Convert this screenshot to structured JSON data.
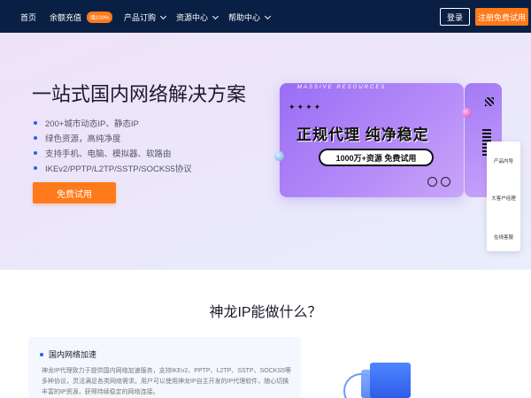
{
  "nav": {
    "home": "首页",
    "recharge": "余额充值",
    "recharge_badge": "赠100%",
    "products": "产品订购",
    "resources": "资源中心",
    "help": "帮助中心",
    "login": "登录",
    "register": "注册免费试用"
  },
  "hero": {
    "title": "一站式国内网络解决方案",
    "features": [
      "200+城市动态IP、静态IP",
      "绿色资源，高纯净度",
      "支持手机、电脑、模拟器、软路由",
      "IKEv2/PPTP/L2TP/SSTP/SOCKS5协议"
    ],
    "cta": "免费试用"
  },
  "ticket": {
    "tag": "MASSIVE RESOURCES",
    "stars": "✦✦✦✦",
    "main": "正规代理  纯净稳定",
    "sub": "1000万+资源  免费试用"
  },
  "float_panel": {
    "items": [
      "产品内导",
      "大客户经理",
      "在线客服"
    ]
  },
  "section": {
    "title": "神龙IP能做什么？",
    "card_title": "国内网络加速",
    "card_desc": "神龙IP代理致力于提供国内网络加速服务，支持IKEv2、PPTP、L2TP、SSTP、SOCKS5等多种协议，灵活满足各类网络需求。用户可以使用神龙IP自主开发的IP代理软件，随心切换丰富的IP资源，获得持续稳定的网络连接。"
  },
  "colors": {
    "nav_bg": "#0a1f44",
    "accent": "#ff7a1a",
    "primary": "#2f5ce8",
    "ticket": "#9a6df5"
  }
}
